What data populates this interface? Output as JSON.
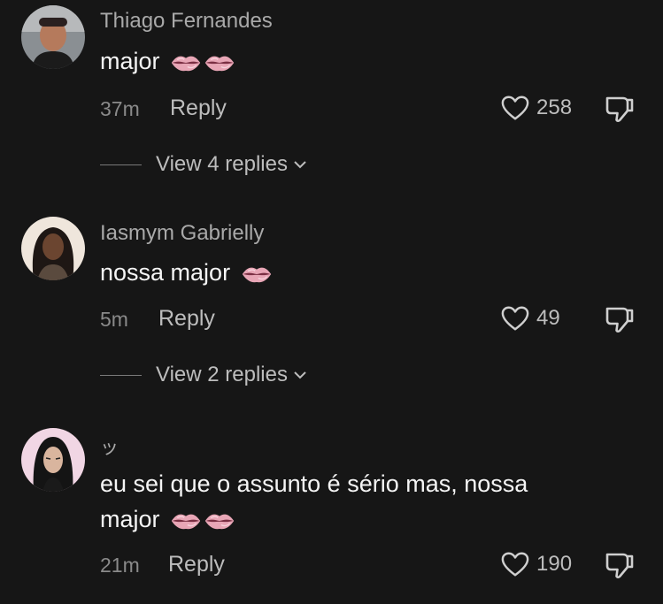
{
  "comments": [
    {
      "username": "Thiago Fernandes",
      "text": "major",
      "time": "37m",
      "reply_label": "Reply",
      "likes": "258",
      "view_replies": "View 4 replies"
    },
    {
      "username": "Iasmym Gabrielly",
      "text": "nossa major",
      "time": "5m",
      "reply_label": "Reply",
      "likes": "49",
      "view_replies": "View 2 replies"
    },
    {
      "username": "ッ",
      "text_line1": "eu sei que o assunto é sério mas, nossa",
      "text_line2": "major",
      "time": "21m",
      "reply_label": "Reply",
      "likes": "190"
    }
  ],
  "icons": {
    "lips": "lips-emoji",
    "like": "heart-outline-icon",
    "dislike": "thumbs-down-outline-icon",
    "expand": "chevron-down-icon"
  },
  "colors": {
    "background": "#161616",
    "username": "#a9a9a9",
    "text": "#f5f5f5",
    "secondary": "#bdbdbd",
    "lips": "#e8a0b0"
  }
}
